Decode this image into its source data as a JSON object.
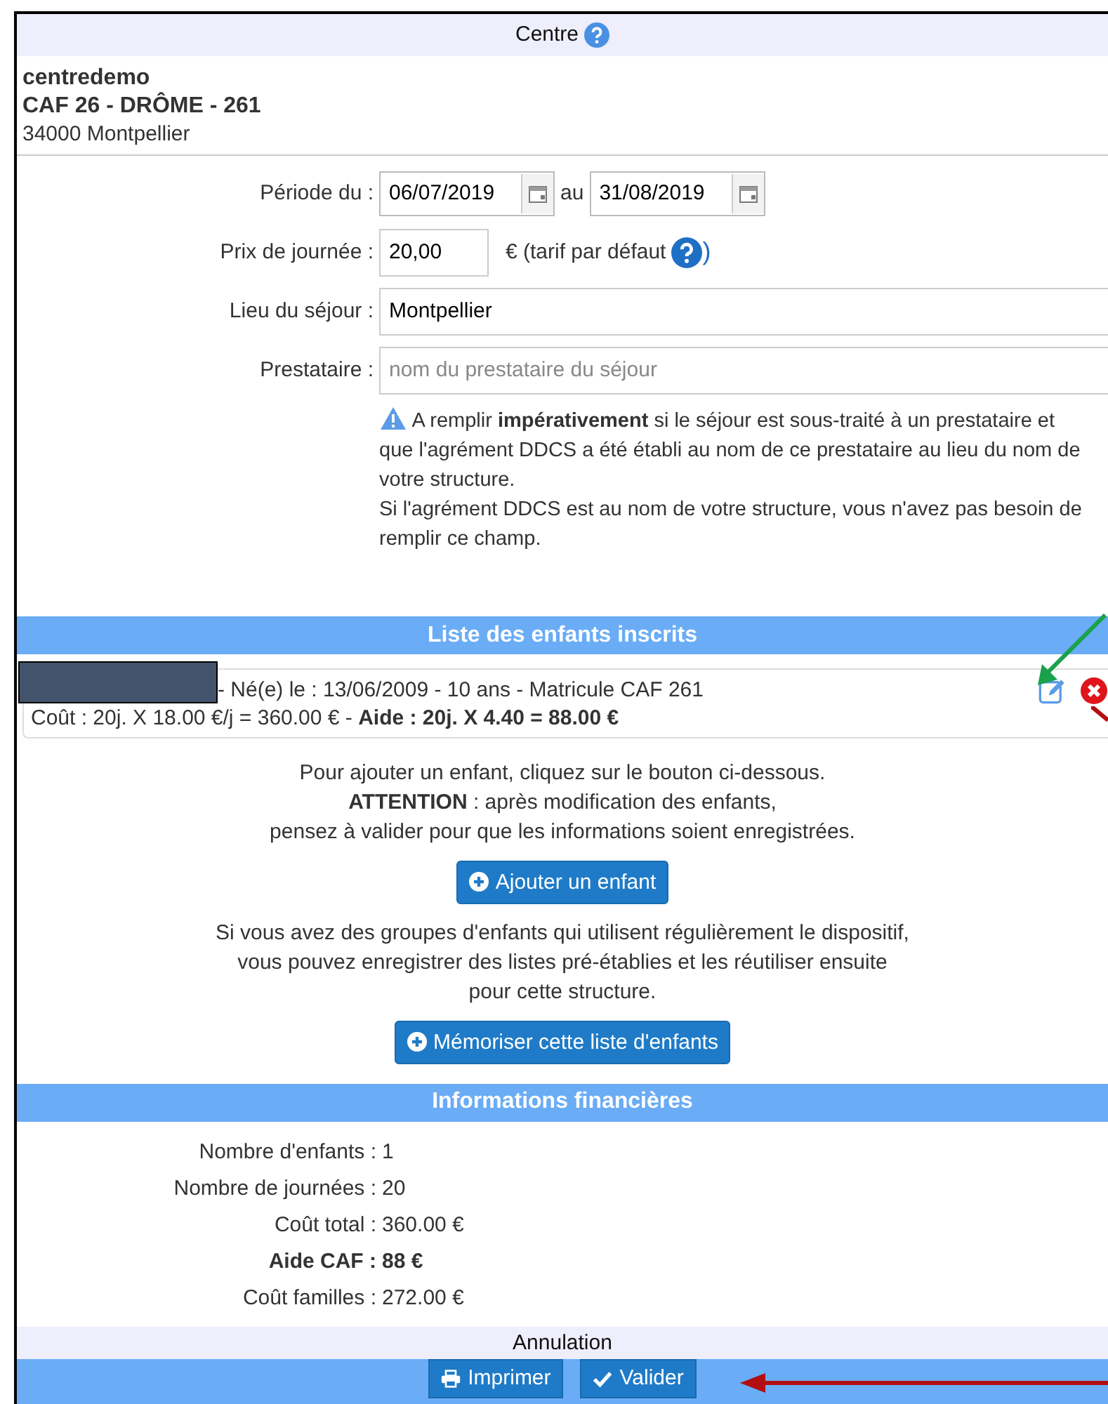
{
  "centre": {
    "title": "Centre",
    "name": "centredemo",
    "caf": "CAF 26 - DRÔME - 261",
    "address": "34000 Montpellier"
  },
  "form": {
    "period": {
      "label": "Période du :",
      "from": "06/07/2019",
      "separator": "au",
      "to": "31/08/2019"
    },
    "price": {
      "label": "Prix de journée :",
      "value": "20,00",
      "note": "€ (tarif par défaut",
      "note_end": ")"
    },
    "place": {
      "label": "Lieu du séjour :",
      "value": "Montpellier"
    },
    "provider": {
      "label": "Prestataire :",
      "placeholder": "nom du prestataire du séjour"
    },
    "warning": [
      "A remplir **impérativement** si le séjour est sous-traité à un prestataire et que l'agrément DDCS a été établi au nom de ce prestataire au lieu du nom de votre structure.",
      "Si l'agrément DDCS est au nom de votre structure, vous n'avez pas besoin de remplir ce champ."
    ]
  },
  "children": {
    "title": "Liste des enfants inscrits",
    "items": [
      {
        "line1": "- Né(e) le : 13/06/2009 - 10 ans - Matricule CAF 261",
        "line2": "Coût : 20j. X 18.00 €/j = 360.00 € - **Aide : 20j. X 4.40 = 88.00 €**"
      }
    ],
    "help": [
      "Pour ajouter un enfant, cliquez sur le bouton ci-dessous.",
      "**ATTENTION** : après modification des enfants,",
      "pensez à valider pour que les informations soient enregistrées."
    ],
    "add_button": "Ajouter un enfant",
    "memo_help": [
      "Si vous avez des groupes d'enfants qui utilisent régulièrement le dispositif,",
      "vous pouvez enregistrer des listes pré-établies et les réutiliser ensuite",
      "pour cette structure."
    ],
    "memo_button": "Mémoriser cette liste d'enfants"
  },
  "finance": {
    "title": "Informations financières",
    "rows": [
      {
        "label": "Nombre d'enfants :",
        "value": "1",
        "kind": "normal"
      },
      {
        "label": "Nombre de journées :",
        "value": "20",
        "kind": "normal"
      },
      {
        "label": "Coût total :",
        "value": "360.00 €",
        "kind": "normal"
      },
      {
        "label": "Aide CAF :",
        "value": "88 €",
        "kind": "strong"
      },
      {
        "label": "Coût familles :",
        "value": "272.00 €",
        "kind": "normal"
      }
    ]
  },
  "footer": {
    "cancel": "Annulation",
    "print": "Imprimer",
    "validate": "Valider"
  }
}
